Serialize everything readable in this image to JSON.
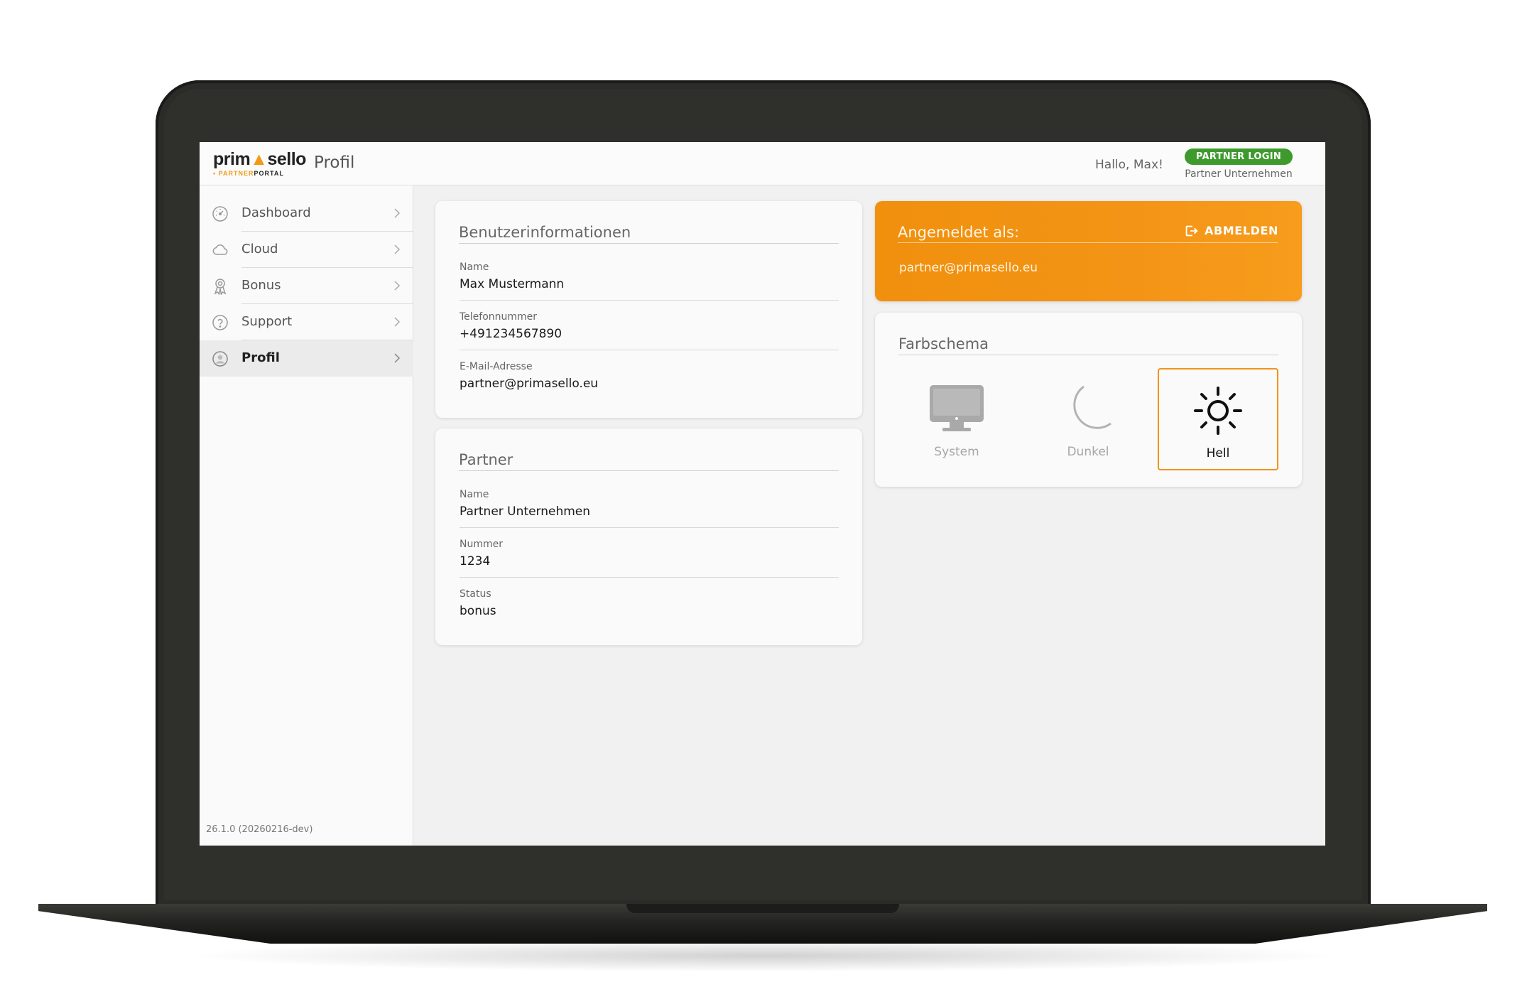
{
  "header": {
    "logo_main_a": "prim",
    "logo_main_b": "sello",
    "logo_sub_a": "PARTNER",
    "logo_sub_b": "PORTAL",
    "page_title": "Profil",
    "greeting": "Hallo, Max!",
    "badge": "PARTNER LOGIN",
    "company": "Partner Unternehmen"
  },
  "sidebar": {
    "items": [
      {
        "label": "Dashboard",
        "icon": "gauge-icon"
      },
      {
        "label": "Cloud",
        "icon": "cloud-icon"
      },
      {
        "label": "Bonus",
        "icon": "award-icon"
      },
      {
        "label": "Support",
        "icon": "help-circle-icon"
      },
      {
        "label": "Profil",
        "icon": "user-circle-icon",
        "active": true
      }
    ],
    "version": "26.1.0 (20260216-dev)"
  },
  "user_card": {
    "title": "Benutzerinformationen",
    "fields": [
      {
        "label": "Name",
        "value": "Max Mustermann"
      },
      {
        "label": "Telefonnummer",
        "value": "+491234567890"
      },
      {
        "label": "E-Mail-Adresse",
        "value": "partner@primasello.eu"
      }
    ]
  },
  "partner_card": {
    "title": "Partner",
    "fields": [
      {
        "label": "Name",
        "value": "Partner Unternehmen"
      },
      {
        "label": "Nummer",
        "value": "1234"
      },
      {
        "label": "Status",
        "value": "bonus"
      }
    ]
  },
  "session_card": {
    "title": "Angemeldet als:",
    "logout_label": "ABMELDEN",
    "email": "partner@primasello.eu"
  },
  "theme_card": {
    "title": "Farbschema",
    "options": [
      {
        "label": "System",
        "icon": "monitor-icon"
      },
      {
        "label": "Dunkel",
        "icon": "moon-icon"
      },
      {
        "label": "Hell",
        "icon": "sun-icon",
        "selected": true
      }
    ]
  },
  "colors": {
    "accent_orange": "#f39318",
    "badge_green": "#3f9a2e",
    "laptop_frame": "#2f2f2b"
  }
}
